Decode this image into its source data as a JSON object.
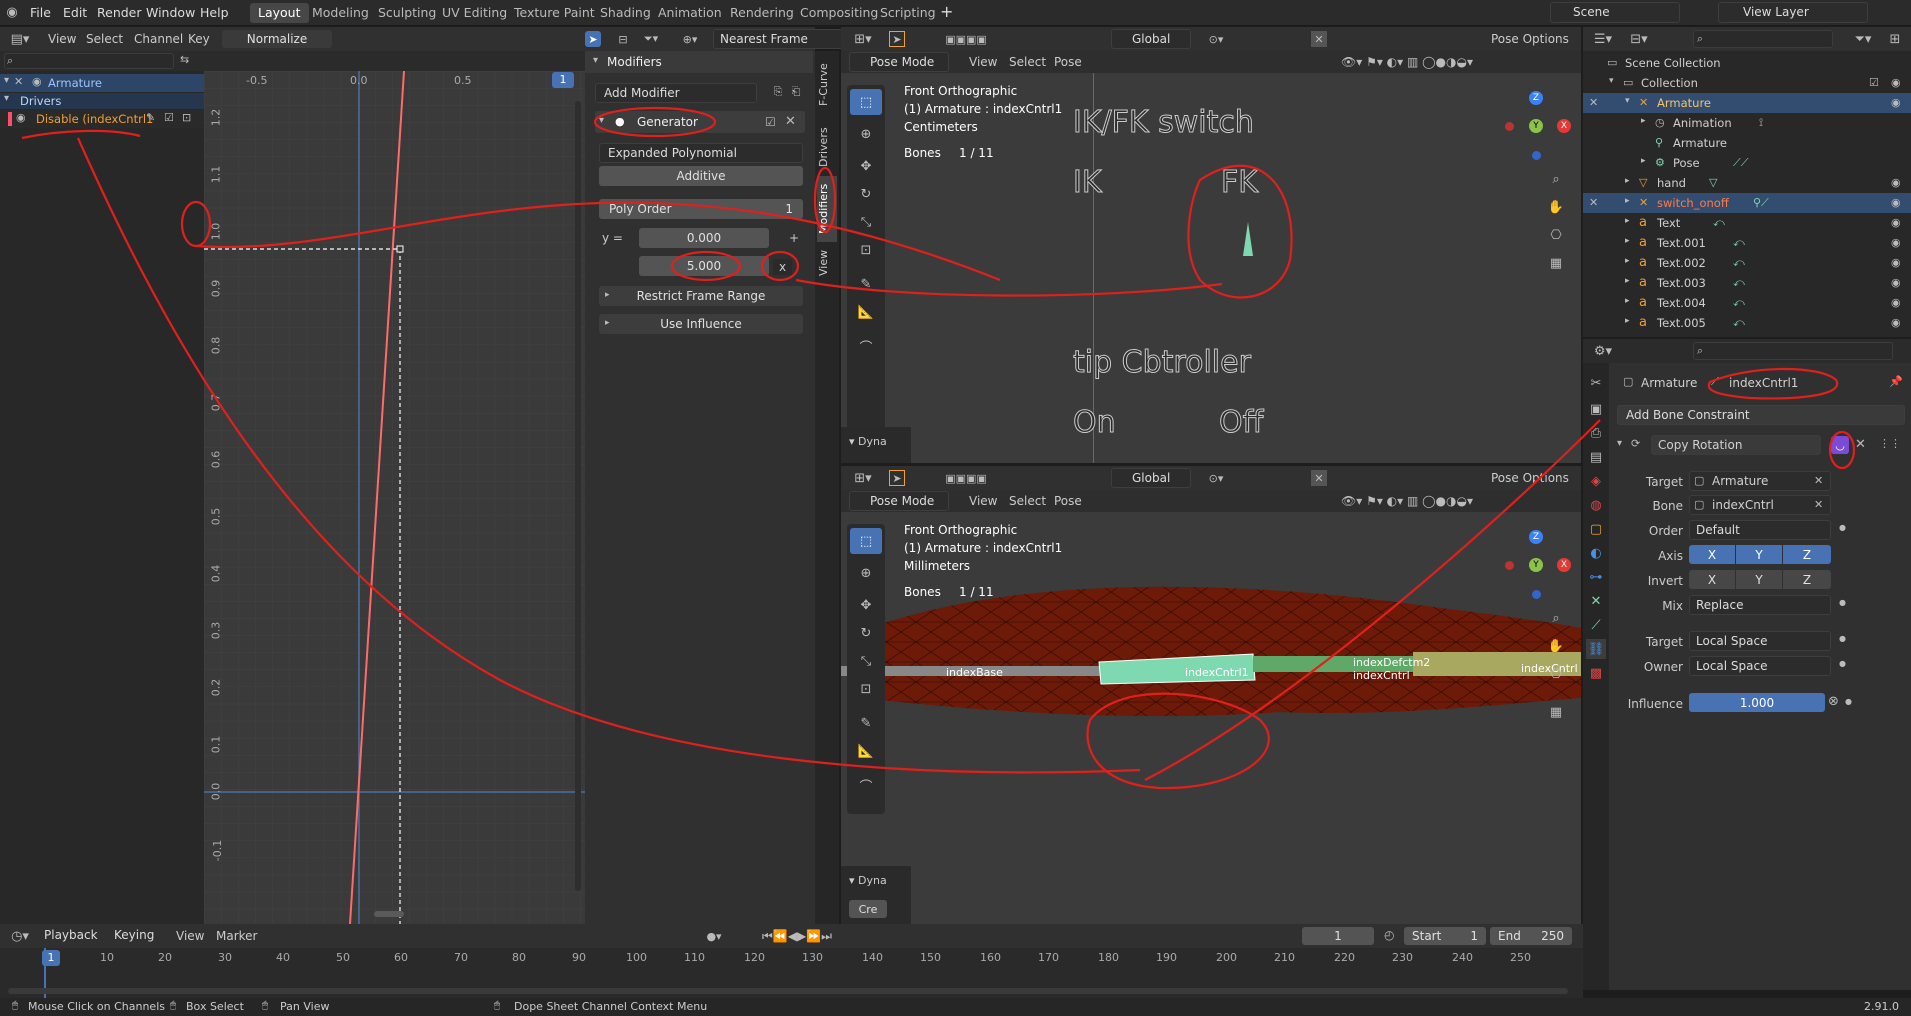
{
  "menus": [
    "File",
    "Edit",
    "Render",
    "Window",
    "Help"
  ],
  "workspaces": [
    "Layout",
    "Modeling",
    "Sculpting",
    "UV Editing",
    "Texture Paint",
    "Shading",
    "Animation",
    "Rendering",
    "Compositing",
    "Scripting"
  ],
  "scene": "Scene",
  "view_layer": "View Layer",
  "graph": {
    "header": {
      "view": "View",
      "select": "Select",
      "channel": "Channel",
      "key": "Key",
      "normalize": "Normalize",
      "interp": "Nearest Frame",
      "frame": "1"
    },
    "x_ticks": [
      "-0.5",
      "0.0",
      "0.5"
    ],
    "y_ticks": [
      "1.2",
      "1.1",
      "1.0",
      "0.9",
      "0.8",
      "0.7",
      "0.6",
      "0.5",
      "0.4",
      "0.3",
      "0.2",
      "0.1",
      "0.0",
      "-0.1"
    ],
    "channels": {
      "armature": "Armature",
      "drivers": "Drivers",
      "driver": "Disable (indexCntrl1"
    }
  },
  "modifiers": {
    "title": "Modifiers",
    "add": "Add Modifier",
    "generator": "Generator",
    "mode": "Expanded Polynomial",
    "additive": "Additive",
    "poly_order_label": "Poly Order",
    "poly_order": "1",
    "y_eq": "y =",
    "c0": "0.000",
    "c1": "5.000",
    "x": "x",
    "restrict": "Restrict Frame Range",
    "influence": "Use Influence",
    "tabs": [
      "F-Curve",
      "Drivers",
      "Modifiers",
      "View"
    ]
  },
  "viewport_top": {
    "mode": "Pose Mode",
    "view": "View",
    "select": "Select",
    "pose": "Pose",
    "orient": "Global",
    "pose_options": "Pose Options",
    "info1": "Front Orthographic",
    "info2": "(1) Armature : indexCntrl1",
    "info3": "Centimeters",
    "bones": "Bones",
    "bones_count": "1 / 11",
    "t_switch": "IK/FK switch",
    "t_ik": "IK",
    "t_fk": "FK",
    "t_tip": "tip Cbtroller",
    "t_on": "On",
    "t_off": "Off",
    "dyna": "Dyna"
  },
  "viewport_bot": {
    "mode": "Pose Mode",
    "view": "View",
    "select": "Select",
    "pose": "Pose",
    "orient": "Global",
    "pose_options": "Pose Options",
    "info1": "Front Orthographic",
    "info2": "(1) Armature : indexCntrl1",
    "info3": "Millimeters",
    "bones": "Bones",
    "bones_count": "1 / 11",
    "b_base": "indexBase",
    "b_ctrl1": "indexCntrl1",
    "b_def2": "indexDefctm2",
    "b_ctrl": "indexCntrl",
    "b_end": "indexCntrl",
    "dyna": "Dyna",
    "cre": "Cre"
  },
  "outliner": {
    "scene_collection": "Scene Collection",
    "items": [
      "Collection",
      "Armature",
      "Animation",
      "Armature",
      "Pose",
      "hand",
      "switch_onoff",
      "Text",
      "Text.001",
      "Text.002",
      "Text.003",
      "Text.004",
      "Text.005"
    ]
  },
  "props": {
    "armature": "Armature",
    "bone": "indexCntrl1",
    "add_constraint": "Add Bone Constraint",
    "constraint": "Copy Rotation",
    "target_label": "Target",
    "target": "Armature",
    "bone_label": "Bone",
    "bone_val": "indexCntrl",
    "order_label": "Order",
    "order": "Default",
    "axis_label": "Axis",
    "invert_label": "Invert",
    "xyz": [
      "X",
      "Y",
      "Z"
    ],
    "mix_label": "Mix",
    "mix": "Replace",
    "tspace_label": "Target",
    "tspace": "Local Space",
    "ospace_label": "Owner",
    "ospace": "Local Space",
    "infl_label": "Influence",
    "infl": "1.000"
  },
  "timeline": {
    "playback": "Playback",
    "keying": "Keying",
    "view": "View",
    "marker": "Marker",
    "frame": "1",
    "start_label": "Start",
    "start": "1",
    "end_label": "End",
    "end": "250",
    "ticks": [
      "1",
      "10",
      "20",
      "30",
      "40",
      "50",
      "60",
      "70",
      "80",
      "90",
      "100",
      "110",
      "120",
      "130",
      "140",
      "150",
      "160",
      "170",
      "180",
      "190",
      "200",
      "210",
      "220",
      "230",
      "240",
      "250"
    ]
  },
  "status": {
    "s1": "Mouse Click on Channels",
    "s2": "Box Select",
    "s3": "Pan View",
    "s4": "Dope Sheet Channel Context Menu",
    "version": "2.91.0"
  },
  "colors": {
    "accent": "#4772b3",
    "curve": "#ff6b6b",
    "annotation": "#e0201c",
    "active_orange": "#f0a030",
    "bone_green": "#7fd9b0"
  }
}
